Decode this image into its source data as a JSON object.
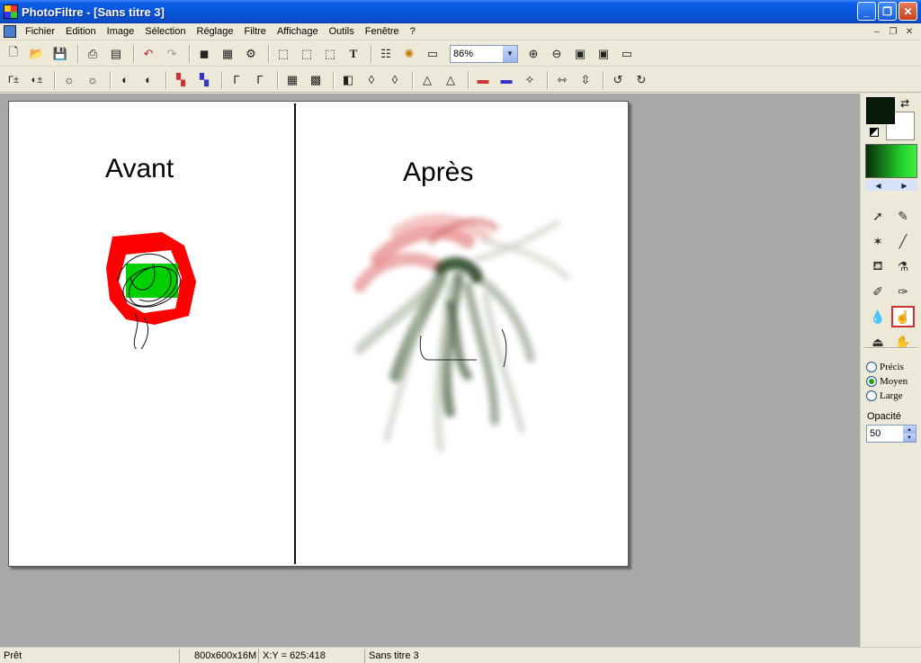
{
  "window": {
    "title": "PhotoFiltre - [Sans titre 3]"
  },
  "menu": {
    "items": [
      "Fichier",
      "Edition",
      "Image",
      "Sélection",
      "Réglage",
      "Filtre",
      "Affichage",
      "Outils",
      "Fenêtre",
      "?"
    ]
  },
  "toolbar": {
    "zoom_value": "86%"
  },
  "canvas": {
    "label_before": "Avant",
    "label_after": "Après"
  },
  "palette": {
    "foreground_color": "#061a08",
    "background_color": "#ffffff",
    "brush_sizes": [
      {
        "label": "Précis",
        "selected": false
      },
      {
        "label": "Moyen",
        "selected": true
      },
      {
        "label": "Large",
        "selected": false
      }
    ],
    "opacity_label": "Opacité",
    "opacity_value": "50",
    "active_tool": "smudge-tool"
  },
  "status": {
    "state": "Prêt",
    "image_size": "800x600x16M",
    "coords": "X:Y = 625:418",
    "doc_name": "Sans titre 3"
  }
}
